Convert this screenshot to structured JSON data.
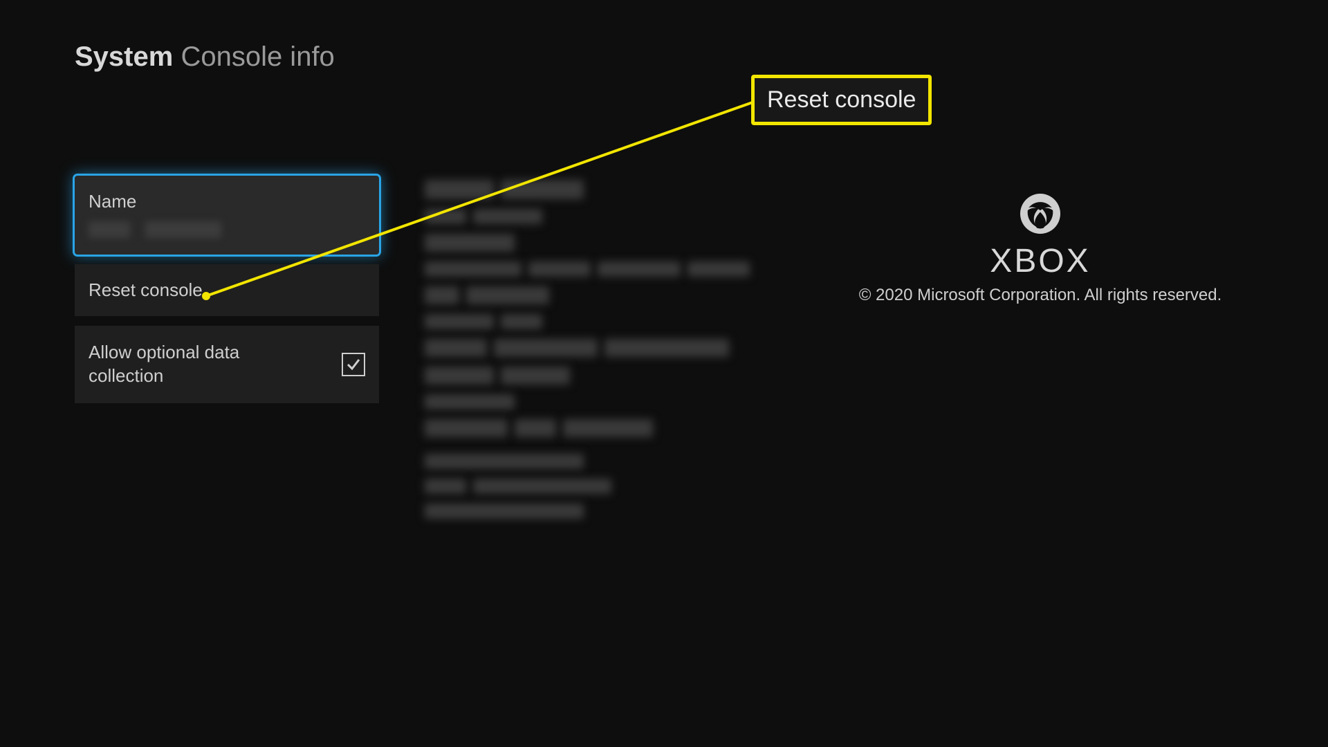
{
  "header": {
    "section": "System",
    "page": "Console info"
  },
  "menu": {
    "name": {
      "label": "Name"
    },
    "reset": {
      "label": "Reset console"
    },
    "dataCollection": {
      "label": "Allow optional data collection",
      "checked": true
    }
  },
  "callout": {
    "text": "Reset console"
  },
  "brand": {
    "name": "XBOX",
    "copyright": "© 2020 Microsoft Corporation. All rights reserved."
  }
}
